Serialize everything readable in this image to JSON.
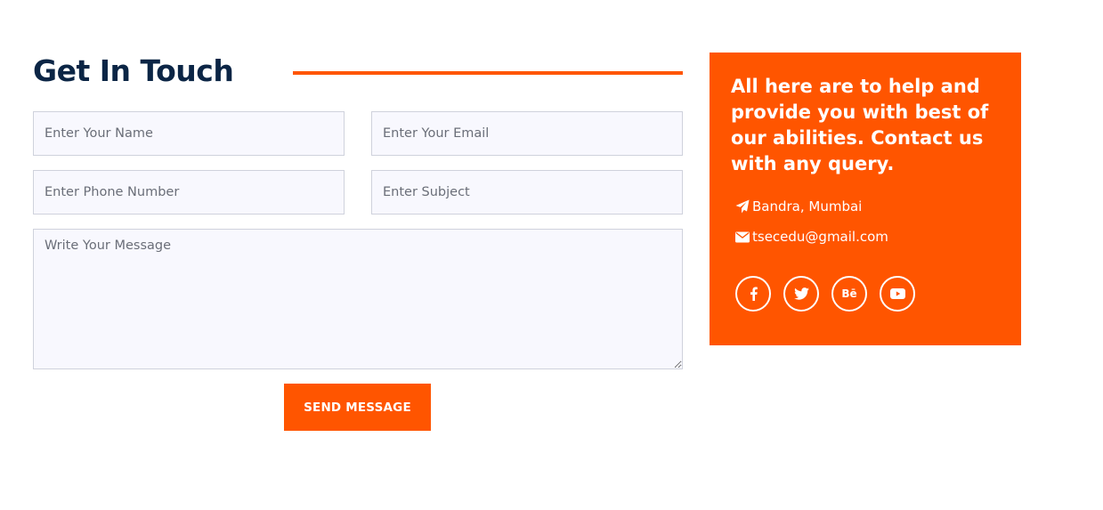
{
  "contact_form": {
    "title": "Get In Touch",
    "name_placeholder": "Enter Your Name",
    "email_placeholder": "Enter Your Email",
    "phone_placeholder": "Enter Phone Number",
    "subject_placeholder": "Enter Subject",
    "message_placeholder": "Write Your Message",
    "submit_label": "SEND MESSAGE"
  },
  "info_card": {
    "text": "All here are to help and provide you with best of our abilities. Contact us with any query.",
    "address": "Bandra, Mumbai",
    "email": "tsecedu@gmail.com",
    "address_icon": "paper-plane-icon",
    "email_icon": "envelope-icon",
    "socials": [
      {
        "icon": "facebook-icon"
      },
      {
        "icon": "twitter-icon"
      },
      {
        "icon": "behance-icon",
        "glyph": "Bē"
      },
      {
        "icon": "youtube-icon"
      }
    ]
  },
  "colors": {
    "accent": "#ff5500",
    "heading": "#0b2545",
    "input_bg": "#f8f8fe",
    "input_border": "#cfd2dc"
  }
}
